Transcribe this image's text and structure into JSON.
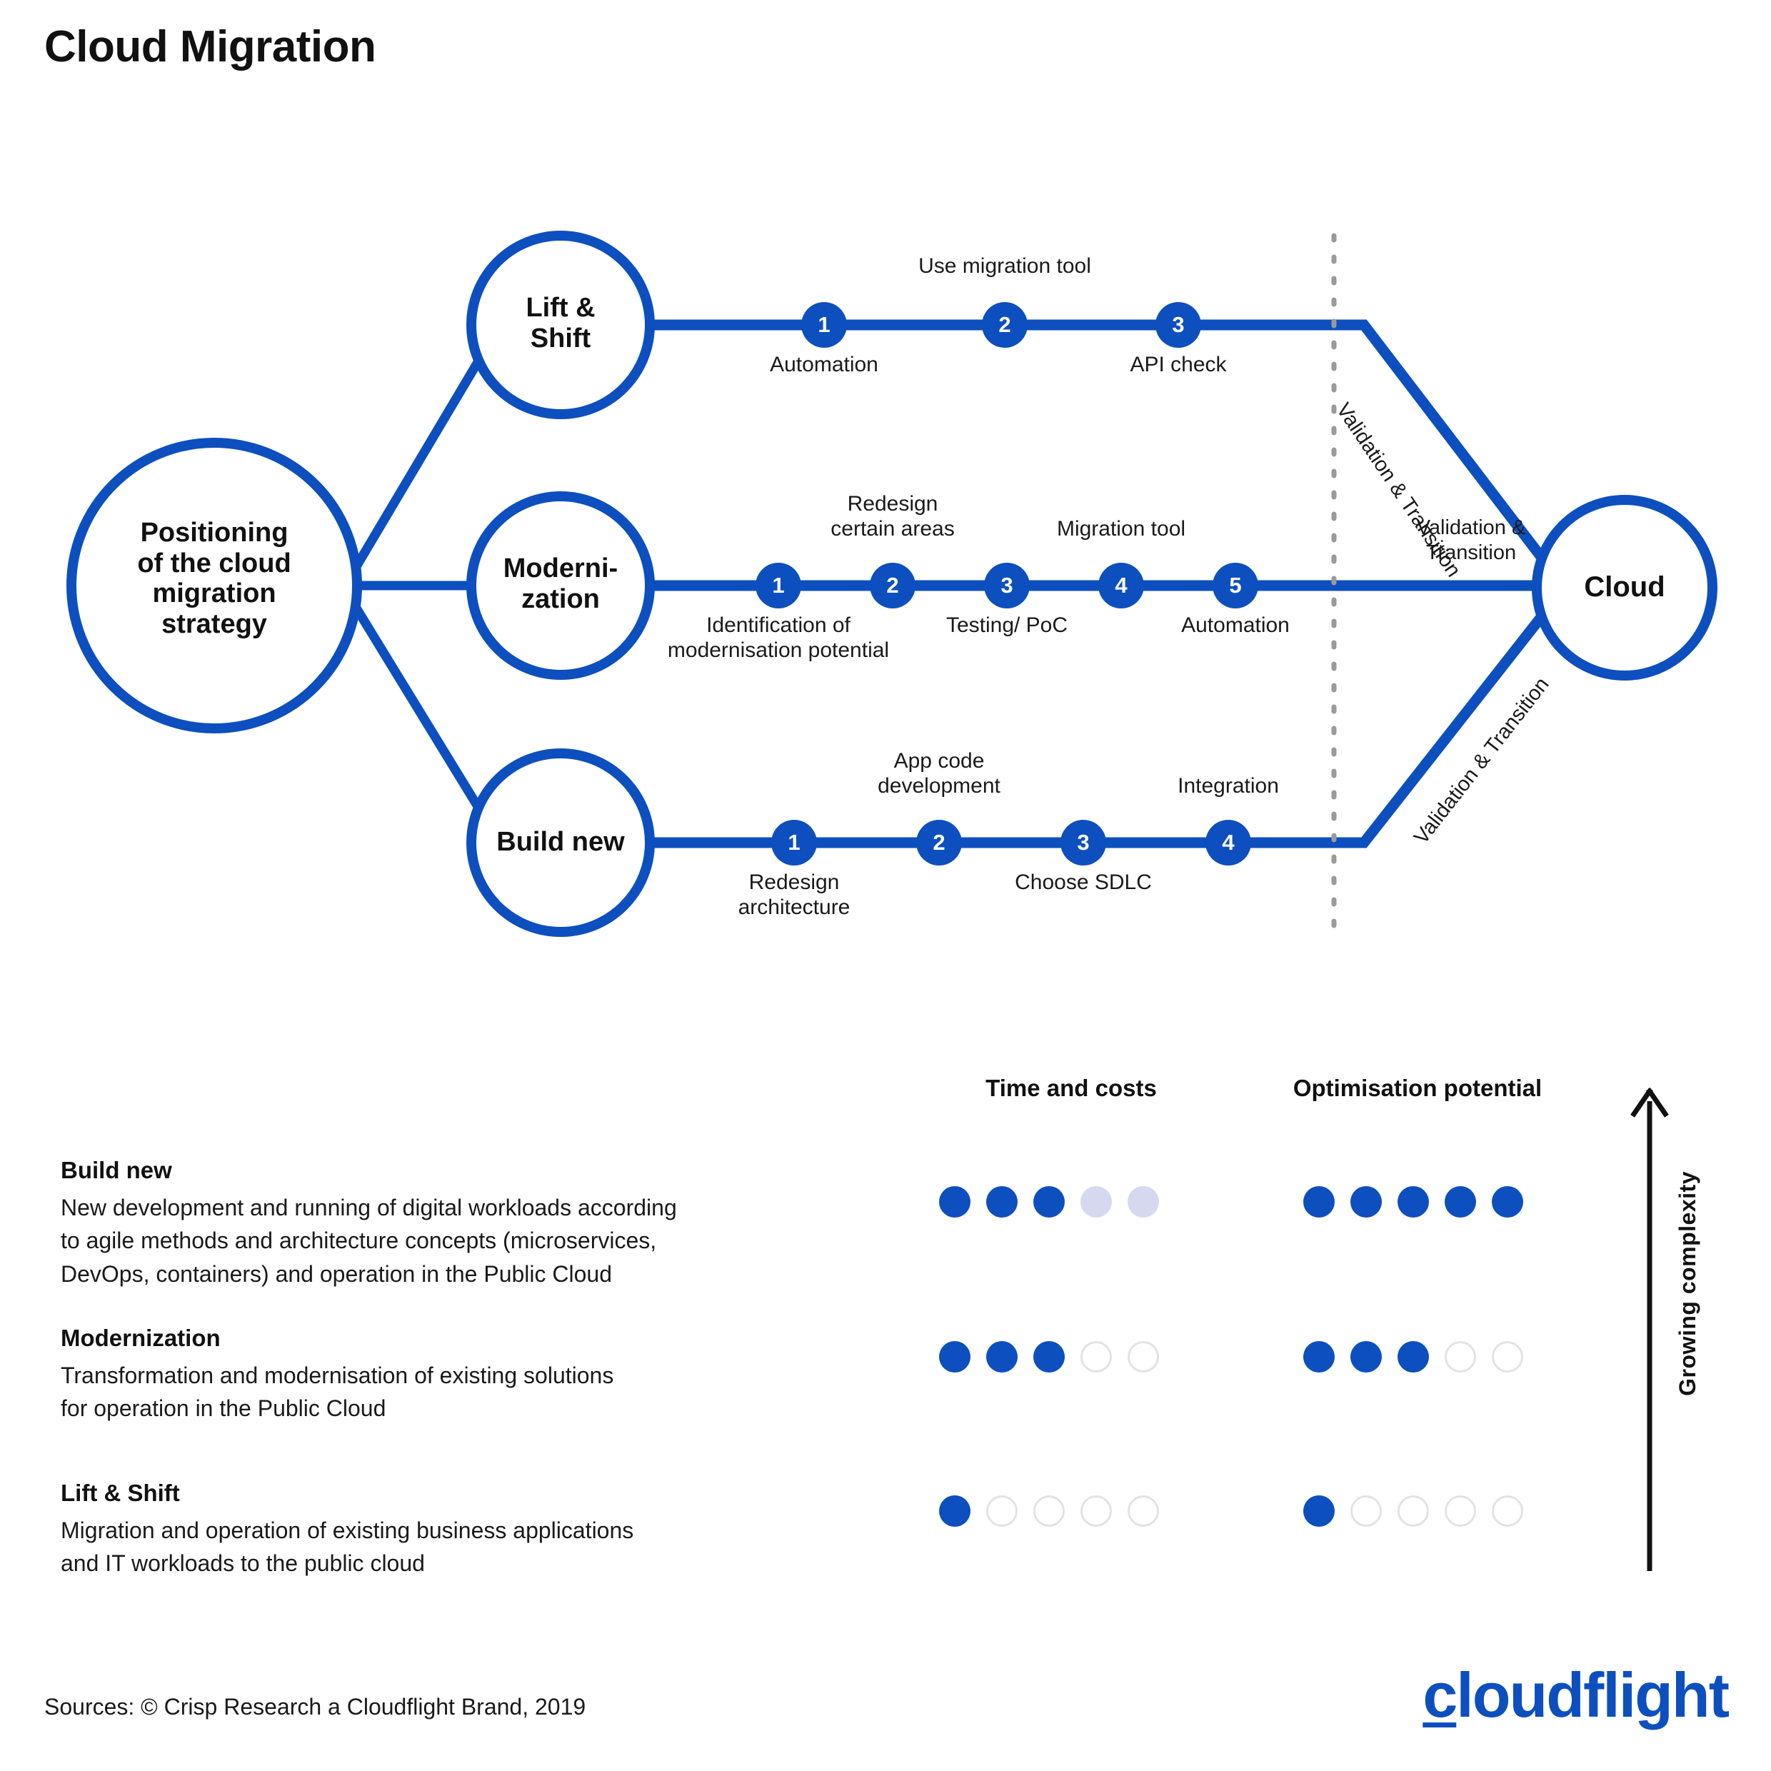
{
  "title": "Cloud Migration",
  "colors": {
    "brand_blue": "#0D4FBE",
    "pale_blue": "#D5D9F0",
    "empty_grey": "#E3E3E3",
    "text_black": "#1a1a1a"
  },
  "diagram": {
    "root_node": "Positioning\nof the cloud\nmigration\nstrategy",
    "target_node": "Cloud",
    "divider": "dotted-vertical-divider",
    "branches": [
      {
        "name": "Lift & Shift",
        "label": "Lift &\nShift",
        "steps": [
          {
            "num": "1",
            "label": "Automation",
            "position": "below"
          },
          {
            "num": "2",
            "label": "Use migration tool",
            "position": "above"
          },
          {
            "num": "3",
            "label": "API check",
            "position": "below"
          }
        ],
        "transition_label": "Validation & Transition"
      },
      {
        "name": "Modernization",
        "label": "Moderni-\nzation",
        "steps": [
          {
            "num": "1",
            "label": "Identification of\nmodernisation potential",
            "position": "below"
          },
          {
            "num": "2",
            "label": "Redesign\ncertain areas",
            "position": "above"
          },
          {
            "num": "3",
            "label": "Testing/ PoC",
            "position": "below"
          },
          {
            "num": "4",
            "label": "Migration tool",
            "position": "above"
          },
          {
            "num": "5",
            "label": "Automation",
            "position": "below"
          }
        ],
        "transition_label": "Validation &\nTransition"
      },
      {
        "name": "Build new",
        "label": "Build new",
        "steps": [
          {
            "num": "1",
            "label": "Redesign\narchitecture",
            "position": "below"
          },
          {
            "num": "2",
            "label": "App code\ndevelopment",
            "position": "above"
          },
          {
            "num": "3",
            "label": "Choose SDLC",
            "position": "below"
          },
          {
            "num": "4",
            "label": "Integration",
            "position": "above"
          }
        ],
        "transition_label": "Validation & Transition"
      }
    ]
  },
  "comparison": {
    "columns": [
      {
        "id": "time_and_costs",
        "label": "Time and costs"
      },
      {
        "id": "optimisation_potential",
        "label": "Optimisation potential"
      }
    ],
    "axis_label": "Growing complexity",
    "axis_direction": "up",
    "max_rating": 5,
    "rows": [
      {
        "name": "Build new",
        "description": "New development and running of digital workloads according\nto agile methods and architecture concepts (microservices,\nDevOps, containers) and operation in the Public Cloud",
        "time_and_costs": {
          "value": 3,
          "styles": [
            "filled",
            "filled",
            "filled",
            "pale",
            "pale"
          ]
        },
        "optimisation_potential": {
          "value": 5,
          "styles": [
            "filled",
            "filled",
            "filled",
            "filled",
            "filled"
          ]
        }
      },
      {
        "name": "Modernization",
        "description": "Transformation and modernisation of existing solutions\nfor operation in the Public Cloud",
        "time_and_costs": {
          "value": 3,
          "styles": [
            "filled",
            "filled",
            "filled",
            "empty",
            "empty"
          ]
        },
        "optimisation_potential": {
          "value": 3,
          "styles": [
            "filled",
            "filled",
            "filled",
            "empty",
            "empty"
          ]
        }
      },
      {
        "name": "Lift & Shift",
        "description": "Migration and operation of existing business applications\nand IT workloads to the public cloud",
        "time_and_costs": {
          "value": 1,
          "styles": [
            "filled",
            "empty",
            "empty",
            "empty",
            "empty"
          ]
        },
        "optimisation_potential": {
          "value": 1,
          "styles": [
            "filled",
            "empty",
            "empty",
            "empty",
            "empty"
          ]
        }
      }
    ]
  },
  "footer": {
    "sources": "Sources: © Crisp Research a Cloudflight Brand, 2019",
    "logo_first": "c",
    "logo_rest": "loudflight"
  }
}
